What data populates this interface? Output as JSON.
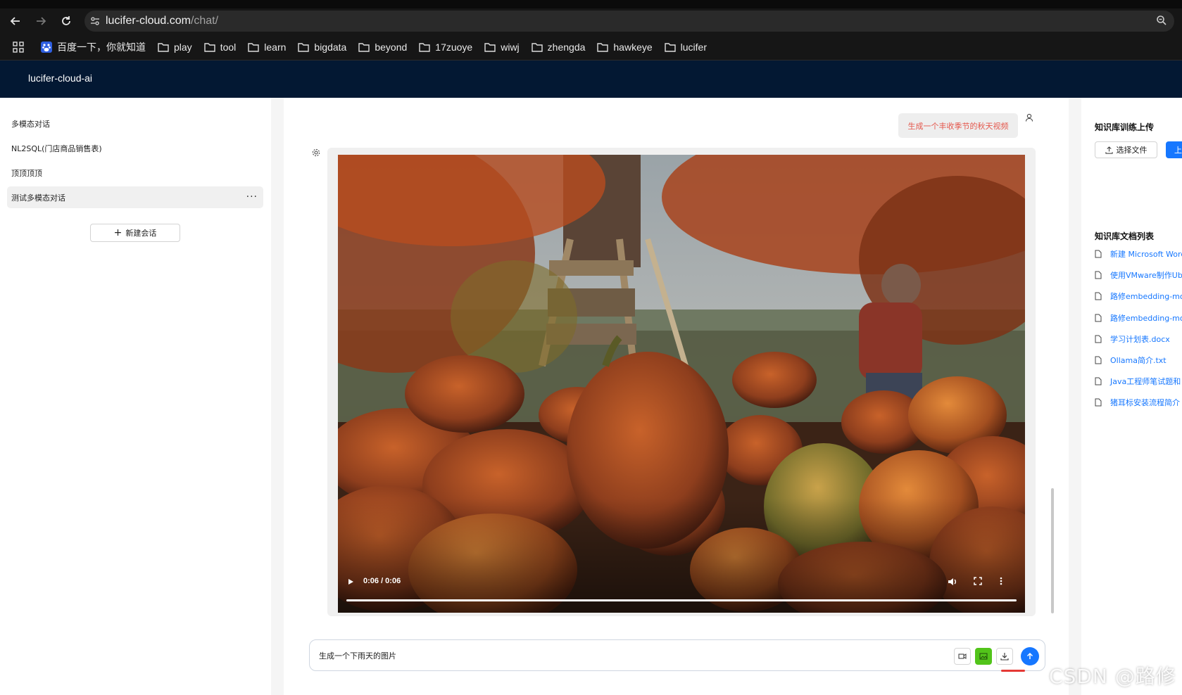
{
  "browser": {
    "url_host": "lucifer-cloud.com",
    "url_path": "/chat/",
    "bookmarks": [
      {
        "label": "百度一下，你就知道",
        "icon": "baidu-icon"
      },
      {
        "label": "play",
        "icon": "folder-icon"
      },
      {
        "label": "tool",
        "icon": "folder-icon"
      },
      {
        "label": "learn",
        "icon": "folder-icon"
      },
      {
        "label": "bigdata",
        "icon": "folder-icon"
      },
      {
        "label": "beyond",
        "icon": "folder-icon"
      },
      {
        "label": "17zuoye",
        "icon": "folder-icon"
      },
      {
        "label": "wiwj",
        "icon": "folder-icon"
      },
      {
        "label": "zhengda",
        "icon": "folder-icon"
      },
      {
        "label": "hawkeye",
        "icon": "folder-icon"
      },
      {
        "label": "lucifer",
        "icon": "folder-icon"
      }
    ]
  },
  "app": {
    "title": "lucifer-cloud-ai",
    "accent_color": "#1677ff",
    "header_color": "#031833"
  },
  "sidebar": {
    "sessions": [
      {
        "label": "多模态对话",
        "active": false
      },
      {
        "label": "NL2SQL(门店商品销售表)",
        "active": false
      },
      {
        "label": "顶顶顶顶",
        "active": false
      },
      {
        "label": "测试多模态对话",
        "active": true
      }
    ],
    "more_label": "···",
    "new_chat_label": "新建会话"
  },
  "chat": {
    "user_message": "生成一个丰收季节的秋天视频",
    "video": {
      "time": "0:06 / 0:06",
      "progress_percent": 100
    },
    "input_value": "生成一个下雨天的图片"
  },
  "right_panel": {
    "upload_title": "知识库训练上传",
    "select_file_label": "选择文件",
    "upload_label": "上",
    "doc_list_title": "知识库文档列表",
    "docs": [
      "新建 Microsoft Word",
      "使用VMware制作Ub",
      "路修embedding-mo",
      "路修embedding-mo",
      "学习计划表.docx",
      "Ollama简介.txt",
      "Java工程师笔试题和",
      "猪耳标安装流程简介"
    ]
  },
  "watermark": "CSDN @路修"
}
